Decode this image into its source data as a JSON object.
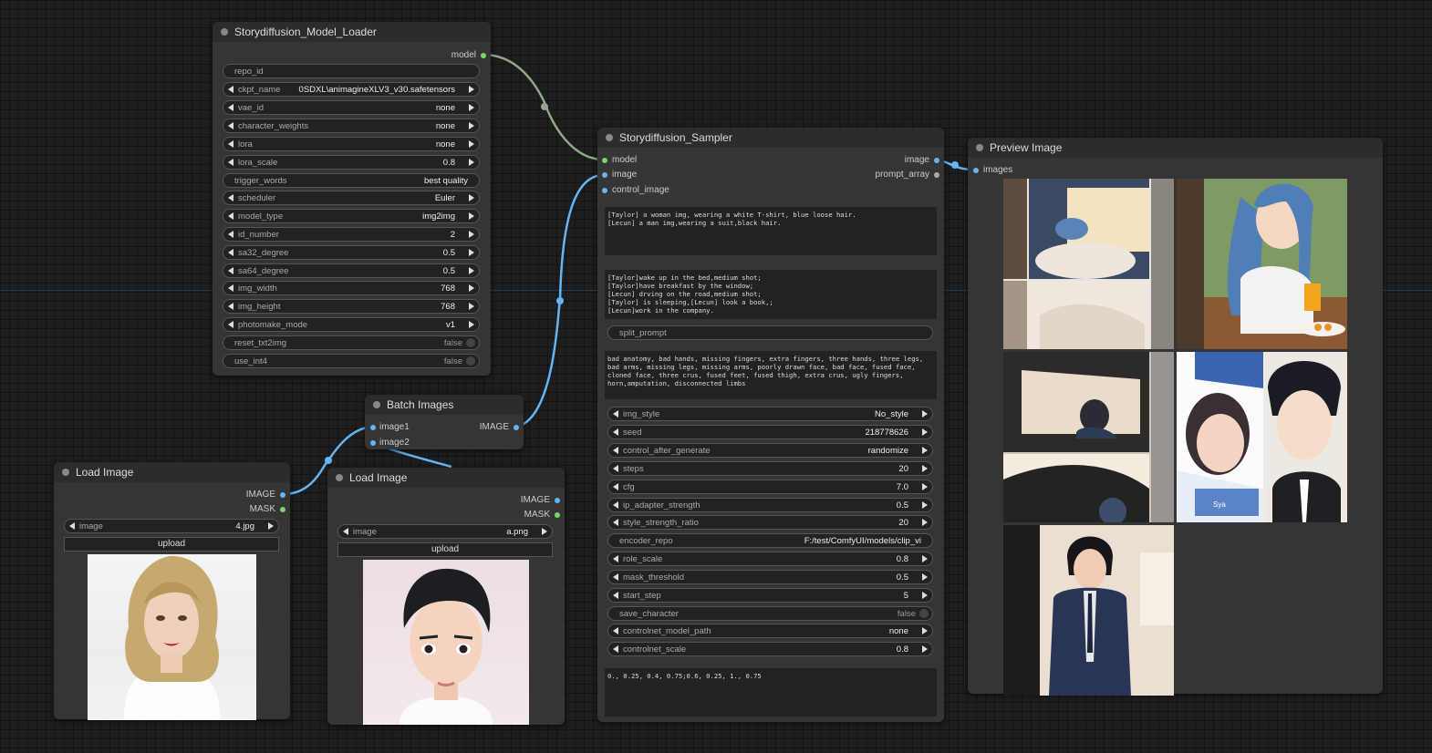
{
  "colors": {
    "model_link": "#8fa88a",
    "image_link": "#64b5f6",
    "node_bg": "#353535",
    "canvas_bg": "#1e1e1e"
  },
  "loader": {
    "title": "Storydiffusion_Model_Loader",
    "output_model": "model",
    "repo_id": "repo_id",
    "ckpt_name_label": "ckpt_name",
    "ckpt_name_value": "0SDXL\\animagineXLV3_v30.safetensors",
    "vae_id_label": "vae_id",
    "vae_id_value": "none",
    "character_weights_label": "character_weights",
    "character_weights_value": "none",
    "lora_label": "lora",
    "lora_value": "none",
    "lora_scale_label": "lora_scale",
    "lora_scale_value": "0.8",
    "trigger_words_label": "trigger_words",
    "trigger_words_value": "best quality",
    "scheduler_label": "scheduler",
    "scheduler_value": "Euler",
    "model_type_label": "model_type",
    "model_type_value": "img2img",
    "id_number_label": "id_number",
    "id_number_value": "2",
    "sa32_label": "sa32_degree",
    "sa32_value": "0.5",
    "sa64_label": "sa64_degree",
    "sa64_value": "0.5",
    "img_width_label": "img_width",
    "img_width_value": "768",
    "img_height_label": "img_height",
    "img_height_value": "768",
    "photomake_label": "photomake_mode",
    "photomake_value": "v1",
    "reset_label": "reset_txt2img",
    "reset_value": "false",
    "use_int4_label": "use_int4",
    "use_int4_value": "false"
  },
  "batch": {
    "title": "Batch Images",
    "in1": "image1",
    "in2": "image2",
    "out": "IMAGE"
  },
  "load1": {
    "title": "Load Image",
    "out_image": "IMAGE",
    "out_mask": "MASK",
    "image_label": "image",
    "image_value": "4.jpg",
    "upload": "upload"
  },
  "load2": {
    "title": "Load Image",
    "out_image": "IMAGE",
    "out_mask": "MASK",
    "image_label": "image",
    "image_value": "a.png",
    "upload": "upload"
  },
  "sampler": {
    "title": "Storydiffusion_Sampler",
    "in_model": "model",
    "in_image": "image",
    "in_control": "control_image",
    "out_image": "image",
    "out_prompt": "prompt_array",
    "character_prompt": "[Taylor] a woman img, wearing a white T-shirt, blue loose hair.\n[Lecun] a man img,wearing a suit,black hair.",
    "scene_prompt": "[Taylor]wake up in the bed,medium shot;\n[Taylor]have breakfast by the window;\n[Lecun] drving on the road,medium shot;\n[Taylor] is sleeping,[Lecun] look a book,;\n[Lecun]work in the company.",
    "split_prompt": "split_prompt",
    "negative_prompt": "bad anatomy, bad hands, missing fingers, extra fingers, three hands, three legs, bad arms, missing legs, missing arms, poorly drawn face, bad face, fused face, cloned face, three crus, fused feet, fused thigh, extra crus, ugly fingers, horn,amputation, disconnected limbs",
    "img_style_label": "img_style",
    "img_style_value": "No_style",
    "seed_label": "seed",
    "seed_value": "218778626",
    "cag_label": "control_after_generate",
    "cag_value": "randomize",
    "steps_label": "steps",
    "steps_value": "20",
    "cfg_label": "cfg",
    "cfg_value": "7.0",
    "ipa_label": "ip_adapter_strength",
    "ipa_value": "0.5",
    "ssr_label": "style_strength_ratio",
    "ssr_value": "20",
    "encoder_label": "encoder_repo",
    "encoder_value": "F:/test/ComfyUI/models/clip_vi",
    "role_label": "role_scale",
    "role_value": "0.8",
    "mask_label": "mask_threshold",
    "mask_value": "0.5",
    "start_label": "start_step",
    "start_value": "5",
    "save_label": "save_character",
    "save_value": "false",
    "cnpath_label": "controlnet_model_path",
    "cnpath_value": "none",
    "cnscale_label": "controlnet_scale",
    "cnscale_value": "0.8",
    "ratio_text": "0., 0.25, 0.4, 0.75;0.6, 0.25, 1., 0.75"
  },
  "preview": {
    "title": "Preview Image",
    "in_images": "images",
    "watermark": "Sya"
  }
}
